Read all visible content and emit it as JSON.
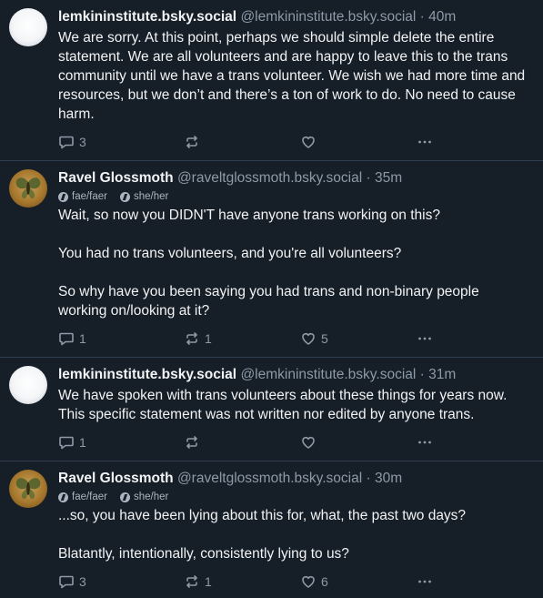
{
  "posts": [
    {
      "author": "lemkininstitute.bsky.social",
      "handle": "@lemkininstitute.bsky.social",
      "time": "40m",
      "avatar": "blank-white-avatar",
      "pronouns": [],
      "paragraphs": [
        "We are sorry. At this point, perhaps we should simple delete the entire statement. We are all volunteers and are happy to leave this to the trans community until we have a trans volunteer. We wish we had more time and resources, but we don’t and there’s a ton of work to do. No need to cause harm."
      ],
      "replies": "3",
      "reposts": "",
      "likes": ""
    },
    {
      "author": "Ravel Glossmoth",
      "handle": "@raveltglossmoth.bsky.social",
      "time": "35m",
      "avatar": "moth-avatar",
      "pronouns": [
        "fae/faer",
        "she/her"
      ],
      "paragraphs": [
        "Wait, so now you DIDN'T have anyone trans working on this?",
        "You had no trans volunteers, and you're all volunteers?",
        "So why have you been saying you had trans and non-binary people working on/looking at it?"
      ],
      "replies": "1",
      "reposts": "1",
      "likes": "5"
    },
    {
      "author": "lemkininstitute.bsky.social",
      "handle": "@lemkininstitute.bsky.social",
      "time": "31m",
      "avatar": "blank-white-avatar",
      "pronouns": [],
      "paragraphs": [
        "We have spoken with trans volunteers about these things for years now. This specific statement was not written nor edited by anyone trans."
      ],
      "replies": "1",
      "reposts": "",
      "likes": ""
    },
    {
      "author": "Ravel Glossmoth",
      "handle": "@raveltglossmoth.bsky.social",
      "time": "30m",
      "avatar": "moth-avatar",
      "pronouns": [
        "fae/faer",
        "she/her"
      ],
      "paragraphs": [
        "...so, you have been lying about this for, what, the past two days?",
        "Blatantly, intentionally, consistently lying to us?"
      ],
      "replies": "3",
      "reposts": "1",
      "likes": "6"
    }
  ],
  "colors": {
    "background": "#161e27",
    "text": "#f1f3f5",
    "muted": "#8d9aa8",
    "divider": "#2e4052"
  },
  "icons": {
    "reply": "speech-bubble-icon",
    "repost": "repost-arrows-icon",
    "like": "heart-icon",
    "more": "ellipsis-icon",
    "pronoun": "pronoun-icon"
  },
  "separator": "·"
}
